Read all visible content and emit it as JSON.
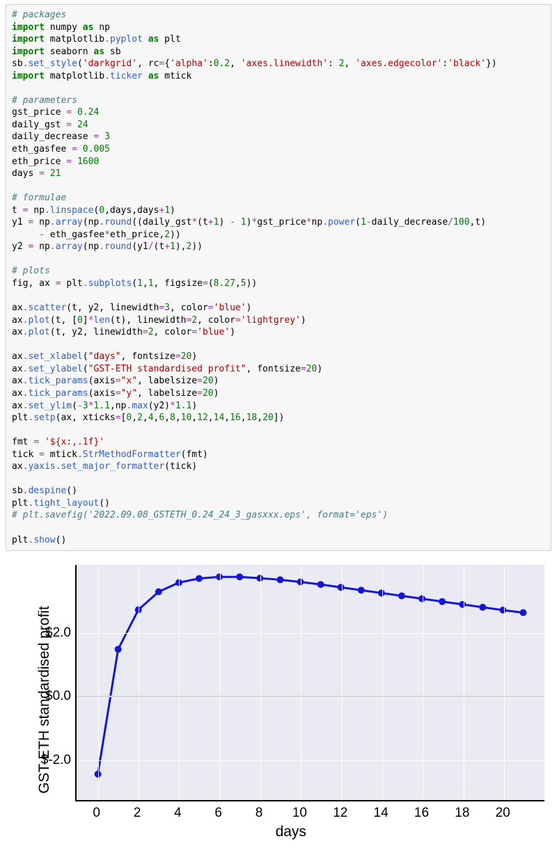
{
  "code": {
    "packages_comment": "# packages",
    "l1a": "import",
    "l1b": " numpy ",
    "l1c": "as",
    "l1d": " np",
    "l2a": "import",
    "l2b": " matplotlib",
    "l2c": ".",
    "l2d": "pyplot ",
    "l2e": "as",
    "l2f": " plt",
    "l3a": "import",
    "l3b": " seaborn ",
    "l3c": "as",
    "l3d": " sb",
    "l4a": "sb",
    "l4b": ".",
    "l4c": "set_style",
    "l4d": "(",
    "l4e": "'darkgrid'",
    "l4f": ", rc",
    "l4g": "=",
    "l4h": "{",
    "l4i": "'alpha'",
    "l4j": ":",
    "l4k": "0.2",
    "l4l": ", ",
    "l4m": "'axes.linewidth'",
    "l4n": ": ",
    "l4o": "2",
    "l4p": ", ",
    "l4q": "'axes.edgecolor'",
    "l4r": ":",
    "l4s": "'black'",
    "l4t": "})",
    "l5a": "import",
    "l5b": " matplotlib",
    "l5c": ".",
    "l5d": "ticker ",
    "l5e": "as",
    "l5f": " mtick",
    "params_comment": "# parameters",
    "p1a": "gst_price ",
    "p1b": "=",
    "p1c": " ",
    "p1d": "0.24",
    "p2a": "daily_gst ",
    "p2b": "=",
    "p2c": " ",
    "p2d": "24",
    "p3a": "daily_decrease ",
    "p3b": "=",
    "p3c": " ",
    "p3d": "3",
    "p4a": "eth_gasfee ",
    "p4b": "=",
    "p4c": " ",
    "p4d": "0.005",
    "p5a": "eth_price ",
    "p5b": "=",
    "p5c": " ",
    "p5d": "1600",
    "p6a": "days ",
    "p6b": "=",
    "p6c": " ",
    "p6d": "21",
    "formulae_comment": "# formulae",
    "f1a": "t ",
    "f1b": "=",
    "f1c": " np",
    "f1d": ".",
    "f1e": "linspace",
    "f1f": "(",
    "f1g": "0",
    "f1h": ",days,days",
    "f1i": "+",
    "f1j": "1",
    "f1k": ")",
    "f2a": "y1 ",
    "f2b": "=",
    "f2c": " np",
    "f2d": ".",
    "f2e": "array",
    "f2f": "(np",
    "f2g": ".",
    "f2h": "round",
    "f2i": "((daily_gst",
    "f2j": "*",
    "f2k": "(t",
    "f2l": "+",
    "f2m": "1",
    "f2n": ") ",
    "f2o": "-",
    "f2p": " ",
    "f2q": "1",
    "f2r": ")",
    "f2s": "*",
    "f2t": "gst_price",
    "f2u": "*",
    "f2v": "np",
    "f2w": ".",
    "f2x": "power",
    "f2y": "(",
    "f2z": "1",
    "f2aa": "-",
    "f2ab": "daily_decrease",
    "f2ac": "/",
    "f2ad": "100",
    "f2ae": ",t)",
    "f2line2a": "     ",
    "f2line2b": "-",
    "f2line2c": " eth_gasfee",
    "f2line2d": "*",
    "f2line2e": "eth_price,",
    "f2line2f": "2",
    "f2line2g": "))",
    "f3a": "y2 ",
    "f3b": "=",
    "f3c": " np",
    "f3d": ".",
    "f3e": "array",
    "f3f": "(np",
    "f3g": ".",
    "f3h": "round",
    "f3i": "(y1",
    "f3j": "/",
    "f3k": "(t",
    "f3l": "+",
    "f3m": "1",
    "f3n": "),",
    "f3o": "2",
    "f3p": "))",
    "plots_comment": "# plots",
    "pl1a": "fig, ax ",
    "pl1b": "=",
    "pl1c": " plt",
    "pl1d": ".",
    "pl1e": "subplots",
    "pl1f": "(",
    "pl1g": "1",
    "pl1h": ",",
    "pl1i": "1",
    "pl1j": ", figsize",
    "pl1k": "=",
    "pl1l": "(",
    "pl1m": "8.27",
    "pl1n": ",",
    "pl1o": "5",
    "pl1p": "))",
    "pl2a": "ax",
    "pl2b": ".",
    "pl2c": "scatter",
    "pl2d": "(t, y2, linewidth",
    "pl2e": "=",
    "pl2f": "3",
    "pl2g": ", color",
    "pl2h": "=",
    "pl2i": "'blue'",
    "pl2j": ")",
    "pl3a": "ax",
    "pl3b": ".",
    "pl3c": "plot",
    "pl3d": "(t, [",
    "pl3e": "0",
    "pl3f": "]",
    "pl3g": "*",
    "pl3h": "len",
    "pl3i": "(t), linewidth",
    "pl3j": "=",
    "pl3k": "2",
    "pl3l": ", color",
    "pl3m": "=",
    "pl3n": "'lightgrey'",
    "pl3o": ")",
    "pl4a": "ax",
    "pl4b": ".",
    "pl4c": "plot",
    "pl4d": "(t, y2, linewidth",
    "pl4e": "=",
    "pl4f": "2",
    "pl4g": ", color",
    "pl4h": "=",
    "pl4i": "'blue'",
    "pl4j": ")",
    "pl5a": "ax",
    "pl5b": ".",
    "pl5c": "set_xlabel",
    "pl5d": "(",
    "pl5e": "\"days\"",
    "pl5f": ", fontsize",
    "pl5g": "=",
    "pl5h": "20",
    "pl5i": ")",
    "pl6a": "ax",
    "pl6b": ".",
    "pl6c": "set_ylabel",
    "pl6d": "(",
    "pl6e": "\"GST-ETH standardised profit\"",
    "pl6f": ", fontsize",
    "pl6g": "=",
    "pl6h": "20",
    "pl6i": ")",
    "pl7a": "ax",
    "pl7b": ".",
    "pl7c": "tick_params",
    "pl7d": "(axis",
    "pl7e": "=",
    "pl7f": "\"x\"",
    "pl7g": ", labelsize",
    "pl7h": "=",
    "pl7i": "20",
    "pl7j": ")",
    "pl8a": "ax",
    "pl8b": ".",
    "pl8c": "tick_params",
    "pl8d": "(axis",
    "pl8e": "=",
    "pl8f": "\"y\"",
    "pl8g": ", labelsize",
    "pl8h": "=",
    "pl8i": "20",
    "pl8j": ")",
    "pl9a": "ax",
    "pl9b": ".",
    "pl9c": "set_ylim",
    "pl9d": "(",
    "pl9e": "-",
    "pl9f": "3",
    "pl9g": "*",
    "pl9h": "1.1",
    "pl9i": ",np",
    "pl9j": ".",
    "pl9k": "max",
    "pl9l": "(y2)",
    "pl9m": "*",
    "pl9n": "1.1",
    "pl9o": ")",
    "pl10a": "plt",
    "pl10b": ".",
    "pl10c": "setp",
    "pl10d": "(ax, xticks",
    "pl10e": "=",
    "pl10f": "[",
    "pl10g": "0",
    "pl10h": ",",
    "pl10i": "2",
    "pl10j": ",",
    "pl10k": "4",
    "pl10l": ",",
    "pl10m": "6",
    "pl10n": ",",
    "pl10o": "8",
    "pl10p": ",",
    "pl10q": "10",
    "pl10r": ",",
    "pl10s": "12",
    "pl10t": ",",
    "pl10u": "14",
    "pl10v": ",",
    "pl10w": "16",
    "pl10x": ",",
    "pl10y": "18",
    "pl10z": ",",
    "pl10aa": "20",
    "pl10ab": "])",
    "pl11a": "fmt ",
    "pl11b": "=",
    "pl11c": " ",
    "pl11d": "'${x:,.1f}'",
    "pl12a": "tick ",
    "pl12b": "=",
    "pl12c": " mtick",
    "pl12d": ".",
    "pl12e": "StrMethodFormatter",
    "pl12f": "(fmt)",
    "pl13a": "ax",
    "pl13b": ".",
    "pl13c": "yaxis",
    "pl13d": ".",
    "pl13e": "set_major_formatter",
    "pl13f": "(tick)",
    "pl14a": "sb",
    "pl14b": ".",
    "pl14c": "despine",
    "pl14d": "()",
    "pl15a": "plt",
    "pl15b": ".",
    "pl15c": "tight_layout",
    "pl15d": "()",
    "savefig_comment": "# plt.savefig('2022.09.08_GSTETH_0.24_24_3_gasxxx.eps', format='eps')",
    "pl16a": "plt",
    "pl16b": ".",
    "pl16c": "show",
    "pl16d": "()"
  },
  "chart_data": {
    "type": "line",
    "x": [
      0,
      1,
      2,
      3,
      4,
      5,
      6,
      7,
      8,
      9,
      10,
      11,
      12,
      13,
      14,
      15,
      16,
      17,
      18,
      19,
      20,
      21
    ],
    "y": [
      -2.48,
      1.47,
      2.72,
      3.29,
      3.58,
      3.71,
      3.76,
      3.76,
      3.72,
      3.67,
      3.6,
      3.52,
      3.43,
      3.34,
      3.25,
      3.16,
      3.07,
      2.98,
      2.89,
      2.8,
      2.71,
      2.63
    ],
    "xlabel": "days",
    "ylabel": "GST-ETH standardised profit",
    "xticks": [
      0,
      2,
      4,
      6,
      8,
      10,
      12,
      14,
      16,
      18,
      20
    ],
    "yticks": [
      -2.0,
      0.0,
      2.0
    ],
    "ytick_labels": [
      "$-2.0",
      "$0.0",
      "$2.0"
    ],
    "ylim": [
      -3.3,
      4.14
    ],
    "xlim": [
      -1.05,
      22.05
    ],
    "line_color": "#1515d8",
    "zero_color": "#d3d3d3"
  }
}
